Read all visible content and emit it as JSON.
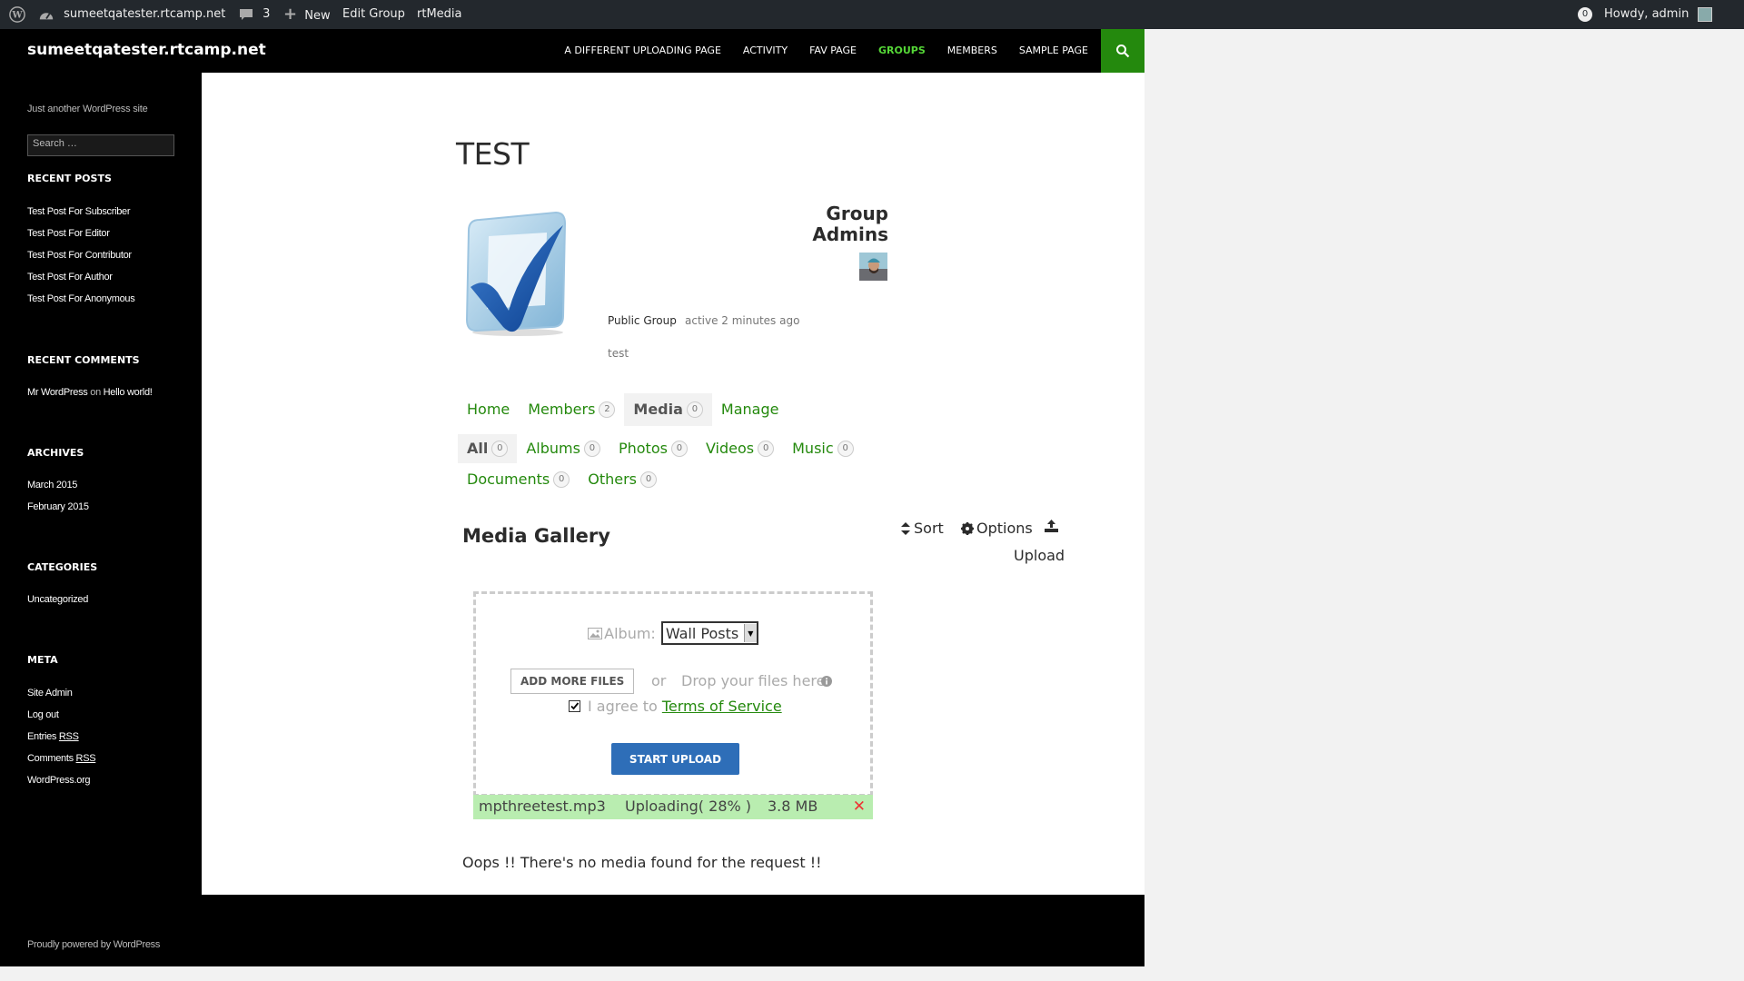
{
  "adminbar": {
    "site_name": "sumeetqatester.rtcamp.net",
    "comments_count": "3",
    "new_label": "New",
    "edit_group_label": "Edit Group",
    "rtmedia_label": "rtMedia",
    "notifications_count": "0",
    "greeting": "Howdy, admin"
  },
  "header": {
    "site_title": "sumeetqatester.rtcamp.net",
    "nav": [
      "A DIFFERENT UPLOADING PAGE",
      "ACTIVITY",
      "FAV PAGE",
      "GROUPS",
      "MEMBERS",
      "SAMPLE PAGE"
    ],
    "active_nav": "GROUPS"
  },
  "sidebar": {
    "tagline": "Just another WordPress site",
    "search_placeholder": "Search …",
    "recent_posts_title": "RECENT POSTS",
    "recent_posts": [
      "Test Post For Subscriber",
      "Test Post For Editor",
      "Test Post For Contributor",
      "Test Post For Author",
      "Test Post For Anonymous"
    ],
    "recent_comments_title": "RECENT COMMENTS",
    "recent_comment": {
      "author": "Mr WordPress",
      "on": "on",
      "post": "Hello world!"
    },
    "archives_title": "ARCHIVES",
    "archives": [
      "March 2015",
      "February 2015"
    ],
    "categories_title": "CATEGORIES",
    "categories": [
      "Uncategorized"
    ],
    "meta_title": "META",
    "meta": {
      "site_admin": "Site Admin",
      "log_out": "Log out",
      "entries": "Entries",
      "comments": "Comments",
      "rss": "RSS",
      "wordpress_org": "WordPress.org"
    }
  },
  "group": {
    "title": "TEST",
    "admins_title": "Group Admins",
    "type": "Public Group",
    "activity": "active 2 minutes ago",
    "description": "test"
  },
  "group_tabs": [
    {
      "label": "Home",
      "count": null
    },
    {
      "label": "Members",
      "count": "2"
    },
    {
      "label": "Media",
      "count": "0"
    },
    {
      "label": "Manage",
      "count": null
    }
  ],
  "media_tabs": [
    {
      "label": "All",
      "count": "0"
    },
    {
      "label": "Albums",
      "count": "0"
    },
    {
      "label": "Photos",
      "count": "0"
    },
    {
      "label": "Videos",
      "count": "0"
    },
    {
      "label": "Music",
      "count": "0"
    },
    {
      "label": "Documents",
      "count": "0"
    },
    {
      "label": "Others",
      "count": "0"
    }
  ],
  "gallery": {
    "title": "Media Gallery",
    "sort_label": "Sort",
    "options_label": "Options",
    "upload_label": "Upload"
  },
  "uploader": {
    "album_label": "Album:",
    "album_selected": "Wall Posts",
    "add_files_label": "ADD MORE FILES",
    "or_label": "or",
    "drop_label": "Drop your files here",
    "agree_label": "I agree to",
    "terms_label": "Terms of Service",
    "start_label": "START UPLOAD",
    "terms_checked": true
  },
  "upload_item": {
    "filename": "mpthreetest.mp3",
    "status": "Uploading( 28% )",
    "progress_percent": 28,
    "size": "3.8 MB"
  },
  "messages": {
    "no_media": "Oops !! There's no media found for the request !!"
  },
  "footer": {
    "credit": "Proudly powered by WordPress"
  },
  "colors": {
    "accent_green": "#24890d",
    "nav_active": "#55d737",
    "button_blue": "#2e6eb8",
    "progress_green": "#b9edb0"
  }
}
